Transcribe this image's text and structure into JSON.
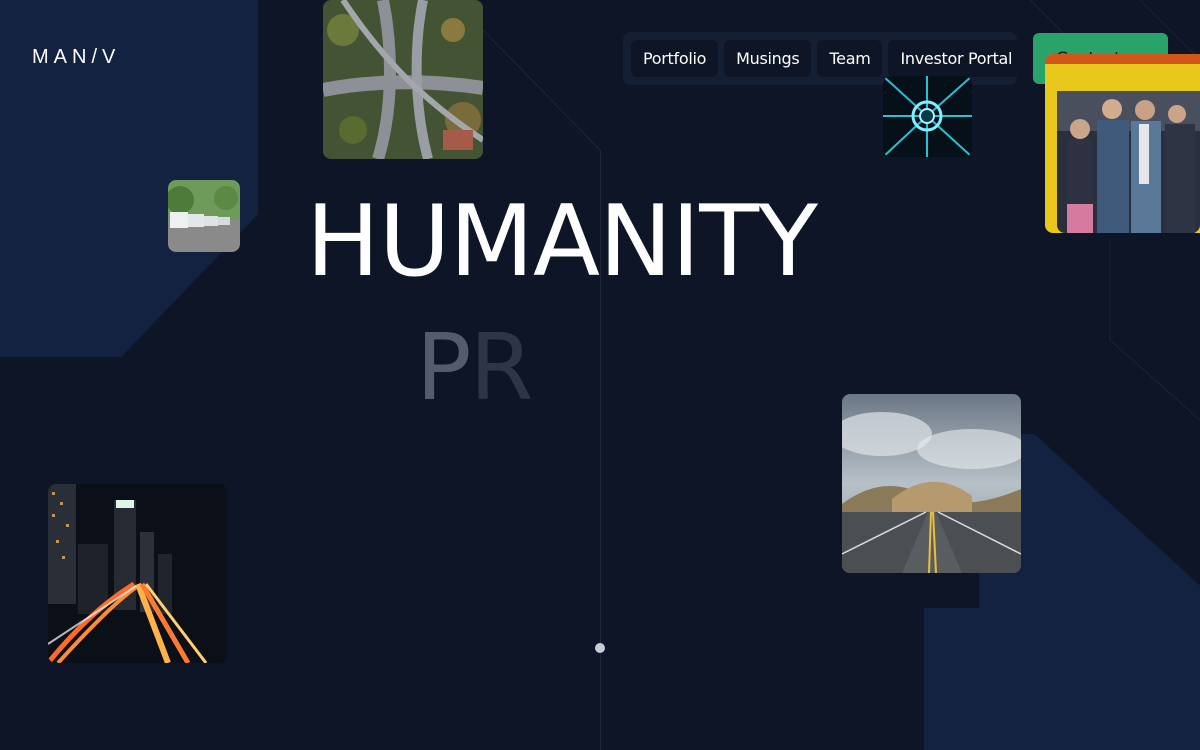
{
  "brand": {
    "logo_text": "MAN/V",
    "accent_color": "#2aa36a"
  },
  "nav": {
    "items": [
      {
        "label": "Portfolio"
      },
      {
        "label": "Musings"
      },
      {
        "label": "Team"
      },
      {
        "label": "Investor Portal"
      }
    ],
    "contact_label": "Contact us"
  },
  "hero": {
    "headline": "HUMANITY",
    "subword_first": "P",
    "subword_second": "R"
  },
  "images": [
    {
      "name": "highway-interchange-aerial"
    },
    {
      "name": "parked-white-vans"
    },
    {
      "name": "blue-light-tunnel"
    },
    {
      "name": "people-on-train"
    },
    {
      "name": "open-road-landscape"
    },
    {
      "name": "city-night-traffic"
    }
  ],
  "colors": {
    "background": "#0d1527",
    "panel": "#122240",
    "nav_bg": "#151f33"
  }
}
